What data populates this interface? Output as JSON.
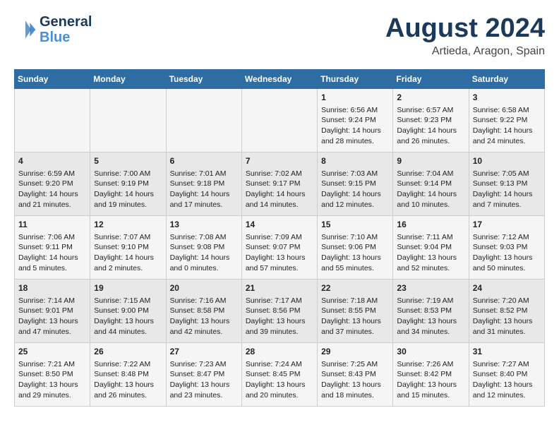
{
  "header": {
    "logo_line1": "General",
    "logo_line2": "Blue",
    "month_title": "August 2024",
    "location": "Artieda, Aragon, Spain"
  },
  "weekdays": [
    "Sunday",
    "Monday",
    "Tuesday",
    "Wednesday",
    "Thursday",
    "Friday",
    "Saturday"
  ],
  "weeks": [
    [
      {
        "day": "",
        "info": ""
      },
      {
        "day": "",
        "info": ""
      },
      {
        "day": "",
        "info": ""
      },
      {
        "day": "",
        "info": ""
      },
      {
        "day": "1",
        "info": "Sunrise: 6:56 AM\nSunset: 9:24 PM\nDaylight: 14 hours\nand 28 minutes."
      },
      {
        "day": "2",
        "info": "Sunrise: 6:57 AM\nSunset: 9:23 PM\nDaylight: 14 hours\nand 26 minutes."
      },
      {
        "day": "3",
        "info": "Sunrise: 6:58 AM\nSunset: 9:22 PM\nDaylight: 14 hours\nand 24 minutes."
      }
    ],
    [
      {
        "day": "4",
        "info": "Sunrise: 6:59 AM\nSunset: 9:20 PM\nDaylight: 14 hours\nand 21 minutes."
      },
      {
        "day": "5",
        "info": "Sunrise: 7:00 AM\nSunset: 9:19 PM\nDaylight: 14 hours\nand 19 minutes."
      },
      {
        "day": "6",
        "info": "Sunrise: 7:01 AM\nSunset: 9:18 PM\nDaylight: 14 hours\nand 17 minutes."
      },
      {
        "day": "7",
        "info": "Sunrise: 7:02 AM\nSunset: 9:17 PM\nDaylight: 14 hours\nand 14 minutes."
      },
      {
        "day": "8",
        "info": "Sunrise: 7:03 AM\nSunset: 9:15 PM\nDaylight: 14 hours\nand 12 minutes."
      },
      {
        "day": "9",
        "info": "Sunrise: 7:04 AM\nSunset: 9:14 PM\nDaylight: 14 hours\nand 10 minutes."
      },
      {
        "day": "10",
        "info": "Sunrise: 7:05 AM\nSunset: 9:13 PM\nDaylight: 14 hours\nand 7 minutes."
      }
    ],
    [
      {
        "day": "11",
        "info": "Sunrise: 7:06 AM\nSunset: 9:11 PM\nDaylight: 14 hours\nand 5 minutes."
      },
      {
        "day": "12",
        "info": "Sunrise: 7:07 AM\nSunset: 9:10 PM\nDaylight: 14 hours\nand 2 minutes."
      },
      {
        "day": "13",
        "info": "Sunrise: 7:08 AM\nSunset: 9:08 PM\nDaylight: 14 hours\nand 0 minutes."
      },
      {
        "day": "14",
        "info": "Sunrise: 7:09 AM\nSunset: 9:07 PM\nDaylight: 13 hours\nand 57 minutes."
      },
      {
        "day": "15",
        "info": "Sunrise: 7:10 AM\nSunset: 9:06 PM\nDaylight: 13 hours\nand 55 minutes."
      },
      {
        "day": "16",
        "info": "Sunrise: 7:11 AM\nSunset: 9:04 PM\nDaylight: 13 hours\nand 52 minutes."
      },
      {
        "day": "17",
        "info": "Sunrise: 7:12 AM\nSunset: 9:03 PM\nDaylight: 13 hours\nand 50 minutes."
      }
    ],
    [
      {
        "day": "18",
        "info": "Sunrise: 7:14 AM\nSunset: 9:01 PM\nDaylight: 13 hours\nand 47 minutes."
      },
      {
        "day": "19",
        "info": "Sunrise: 7:15 AM\nSunset: 9:00 PM\nDaylight: 13 hours\nand 44 minutes."
      },
      {
        "day": "20",
        "info": "Sunrise: 7:16 AM\nSunset: 8:58 PM\nDaylight: 13 hours\nand 42 minutes."
      },
      {
        "day": "21",
        "info": "Sunrise: 7:17 AM\nSunset: 8:56 PM\nDaylight: 13 hours\nand 39 minutes."
      },
      {
        "day": "22",
        "info": "Sunrise: 7:18 AM\nSunset: 8:55 PM\nDaylight: 13 hours\nand 37 minutes."
      },
      {
        "day": "23",
        "info": "Sunrise: 7:19 AM\nSunset: 8:53 PM\nDaylight: 13 hours\nand 34 minutes."
      },
      {
        "day": "24",
        "info": "Sunrise: 7:20 AM\nSunset: 8:52 PM\nDaylight: 13 hours\nand 31 minutes."
      }
    ],
    [
      {
        "day": "25",
        "info": "Sunrise: 7:21 AM\nSunset: 8:50 PM\nDaylight: 13 hours\nand 29 minutes."
      },
      {
        "day": "26",
        "info": "Sunrise: 7:22 AM\nSunset: 8:48 PM\nDaylight: 13 hours\nand 26 minutes."
      },
      {
        "day": "27",
        "info": "Sunrise: 7:23 AM\nSunset: 8:47 PM\nDaylight: 13 hours\nand 23 minutes."
      },
      {
        "day": "28",
        "info": "Sunrise: 7:24 AM\nSunset: 8:45 PM\nDaylight: 13 hours\nand 20 minutes."
      },
      {
        "day": "29",
        "info": "Sunrise: 7:25 AM\nSunset: 8:43 PM\nDaylight: 13 hours\nand 18 minutes."
      },
      {
        "day": "30",
        "info": "Sunrise: 7:26 AM\nSunset: 8:42 PM\nDaylight: 13 hours\nand 15 minutes."
      },
      {
        "day": "31",
        "info": "Sunrise: 7:27 AM\nSunset: 8:40 PM\nDaylight: 13 hours\nand 12 minutes."
      }
    ]
  ]
}
